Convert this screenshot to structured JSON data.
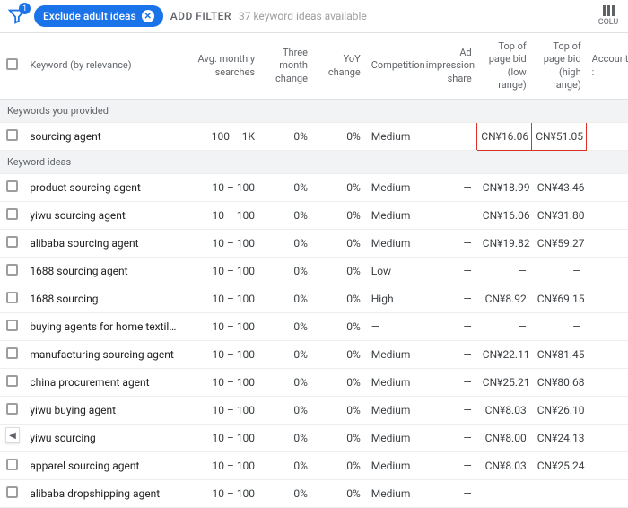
{
  "topbar": {
    "badge": "1",
    "chip_label": "Exclude adult ideas",
    "add_filter": "ADD FILTER",
    "available": "37 keyword ideas available",
    "columns_label": "COLU"
  },
  "headers": {
    "keyword": "Keyword (by relevance)",
    "avg": "Avg. monthly searches",
    "three_month": "Three month change",
    "yoy": "YoY change",
    "comp": "Competition",
    "impr": "Ad impression share",
    "low": "Top of page bid (low range)",
    "high": "Top of page bid (high range)",
    "account": "Account :"
  },
  "sections": {
    "provided": "Keywords you provided",
    "ideas": "Keyword ideas"
  },
  "rows_provided": [
    {
      "keyword": "sourcing agent",
      "avg": "100 – 1K",
      "tm": "0%",
      "yoy": "0%",
      "comp": "Medium",
      "imp": "—",
      "low": "CN¥16.06",
      "high": "CN¥51.05",
      "hl": true
    }
  ],
  "rows_ideas": [
    {
      "keyword": "product sourcing agent",
      "avg": "10 – 100",
      "tm": "0%",
      "yoy": "0%",
      "comp": "Medium",
      "imp": "—",
      "low": "CN¥18.99",
      "high": "CN¥43.46"
    },
    {
      "keyword": "yiwu sourcing agent",
      "avg": "10 – 100",
      "tm": "0%",
      "yoy": "0%",
      "comp": "Medium",
      "imp": "—",
      "low": "CN¥16.06",
      "high": "CN¥31.80"
    },
    {
      "keyword": "alibaba sourcing agent",
      "avg": "10 – 100",
      "tm": "0%",
      "yoy": "0%",
      "comp": "Medium",
      "imp": "—",
      "low": "CN¥19.82",
      "high": "CN¥59.27"
    },
    {
      "keyword": "1688 sourcing agent",
      "avg": "10 – 100",
      "tm": "0%",
      "yoy": "0%",
      "comp": "Low",
      "imp": "—",
      "low": "—",
      "high": "—"
    },
    {
      "keyword": "1688 sourcing",
      "avg": "10 – 100",
      "tm": "0%",
      "yoy": "0%",
      "comp": "High",
      "imp": "—",
      "low": "CN¥8.92",
      "high": "CN¥69.15"
    },
    {
      "keyword": "buying agents for home textiles",
      "avg": "10 – 100",
      "tm": "0%",
      "yoy": "0%",
      "comp": "—",
      "imp": "—",
      "low": "—",
      "high": "—"
    },
    {
      "keyword": "manufacturing sourcing agent",
      "avg": "10 – 100",
      "tm": "0%",
      "yoy": "0%",
      "comp": "Medium",
      "imp": "—",
      "low": "CN¥22.11",
      "high": "CN¥81.45"
    },
    {
      "keyword": "china procurement agent",
      "avg": "10 – 100",
      "tm": "0%",
      "yoy": "0%",
      "comp": "Medium",
      "imp": "—",
      "low": "CN¥25.21",
      "high": "CN¥80.68"
    },
    {
      "keyword": "yiwu buying agent",
      "avg": "10 – 100",
      "tm": "0%",
      "yoy": "0%",
      "comp": "Medium",
      "imp": "—",
      "low": "CN¥8.03",
      "high": "CN¥26.10"
    },
    {
      "keyword": "yiwu sourcing",
      "avg": "10 – 100",
      "tm": "0%",
      "yoy": "0%",
      "comp": "Medium",
      "imp": "—",
      "low": "CN¥8.00",
      "high": "CN¥24.13"
    },
    {
      "keyword": "apparel sourcing agent",
      "avg": "10 – 100",
      "tm": "0%",
      "yoy": "0%",
      "comp": "Medium",
      "imp": "—",
      "low": "CN¥8.03",
      "high": "CN¥25.24"
    },
    {
      "keyword": "alibaba dropshipping agent",
      "avg": "10 – 100",
      "tm": "0%",
      "yoy": "0%",
      "comp": "Medium",
      "imp": "—",
      "low": "",
      "high": ""
    }
  ]
}
